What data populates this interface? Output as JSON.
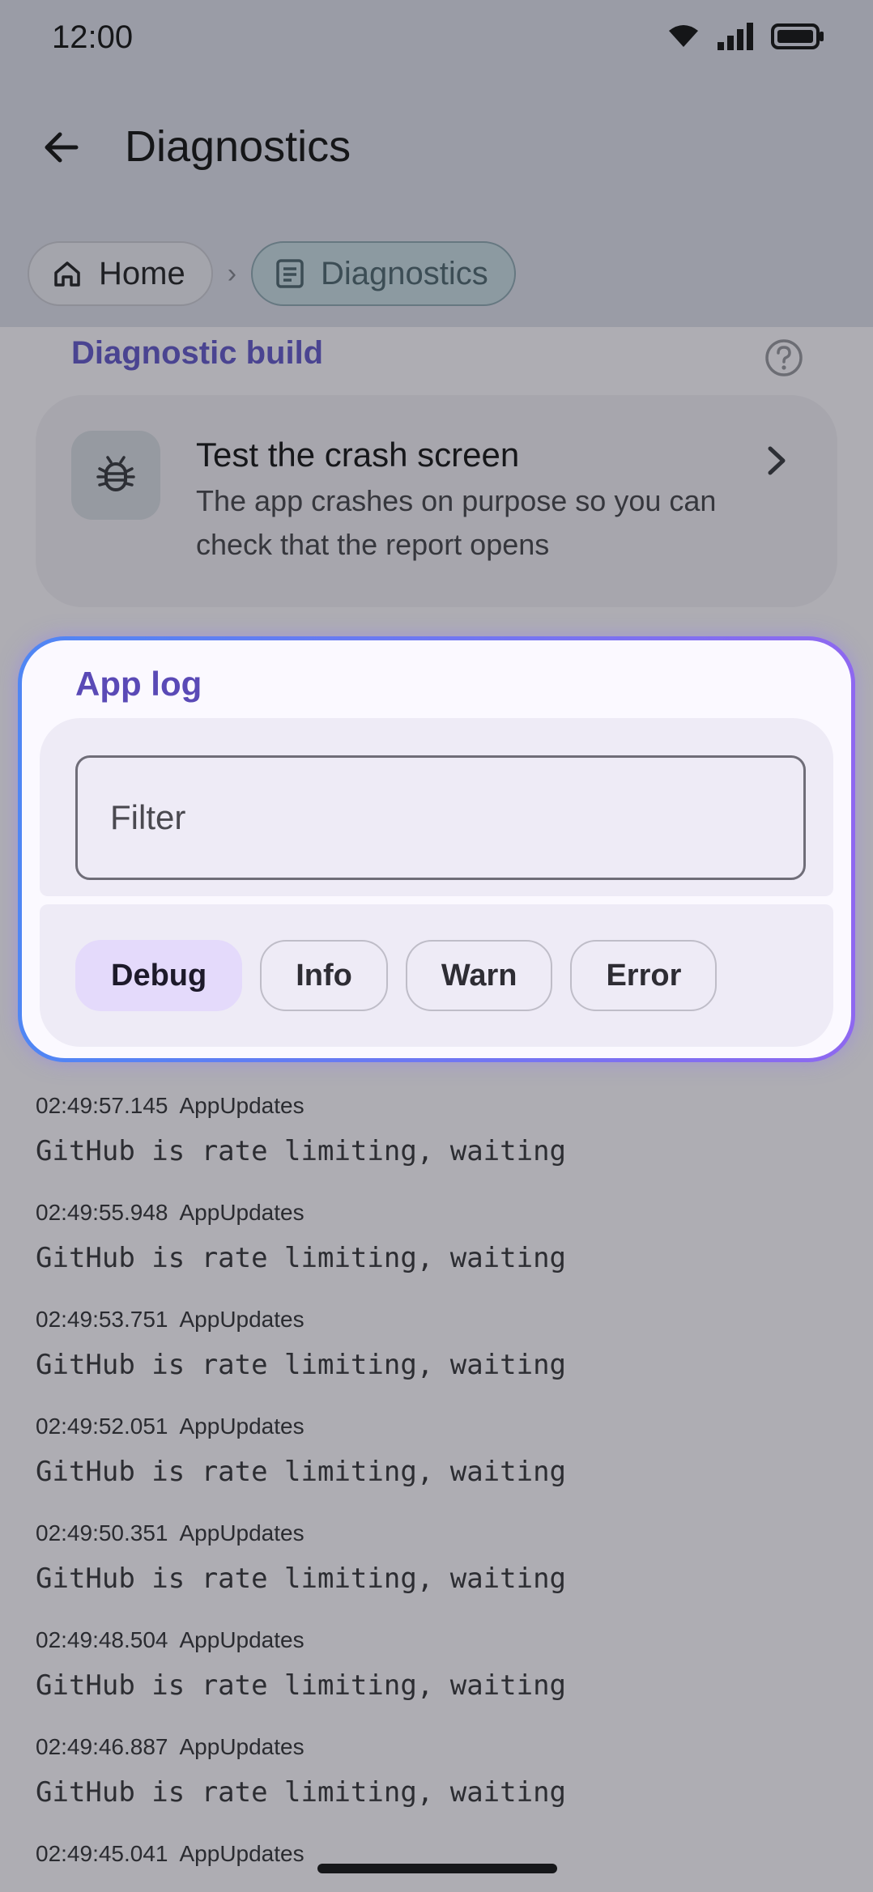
{
  "status_bar": {
    "time": "12:00"
  },
  "app_bar": {
    "title": "Diagnostics"
  },
  "breadcrumb": {
    "home": "Home",
    "current": "Diagnostics",
    "separator": "›"
  },
  "diagnostic_section": {
    "label": "Diagnostic build",
    "card": {
      "title": "Test the crash screen",
      "description": "The app crashes on purpose so you can check that the report opens"
    }
  },
  "app_log": {
    "label": "App log",
    "filter": {
      "placeholder": "Filter",
      "value": ""
    },
    "levels": [
      {
        "label": "Debug",
        "selected": true
      },
      {
        "label": "Info",
        "selected": false
      },
      {
        "label": "Warn",
        "selected": false
      },
      {
        "label": "Error",
        "selected": false
      }
    ]
  },
  "log_entries": [
    {
      "time": "02:49:57.145",
      "source": "AppUpdates",
      "message": "GitHub is rate limiting, waiting"
    },
    {
      "time": "02:49:55.948",
      "source": "AppUpdates",
      "message": "GitHub is rate limiting, waiting"
    },
    {
      "time": "02:49:53.751",
      "source": "AppUpdates",
      "message": "GitHub is rate limiting, waiting"
    },
    {
      "time": "02:49:52.051",
      "source": "AppUpdates",
      "message": "GitHub is rate limiting, waiting"
    },
    {
      "time": "02:49:50.351",
      "source": "AppUpdates",
      "message": "GitHub is rate limiting, waiting"
    },
    {
      "time": "02:49:48.504",
      "source": "AppUpdates",
      "message": "GitHub is rate limiting, waiting"
    },
    {
      "time": "02:49:46.887",
      "source": "AppUpdates",
      "message": "GitHub is rate limiting, waiting"
    },
    {
      "time": "02:49:45.041",
      "source": "AppUpdates",
      "message": ""
    }
  ],
  "icons": {
    "wifi": "wifi-icon",
    "signal": "signal-icon",
    "battery": "battery-icon",
    "back": "arrow-back-icon",
    "home": "home-icon",
    "doc": "document-icon",
    "help": "help-circle-icon",
    "bug": "bug-icon",
    "chevron": "chevron-right-icon"
  },
  "colors": {
    "accent": "#5a4ab6",
    "gradient_start": "#4f86f4",
    "gradient_end": "#8e68f0"
  }
}
